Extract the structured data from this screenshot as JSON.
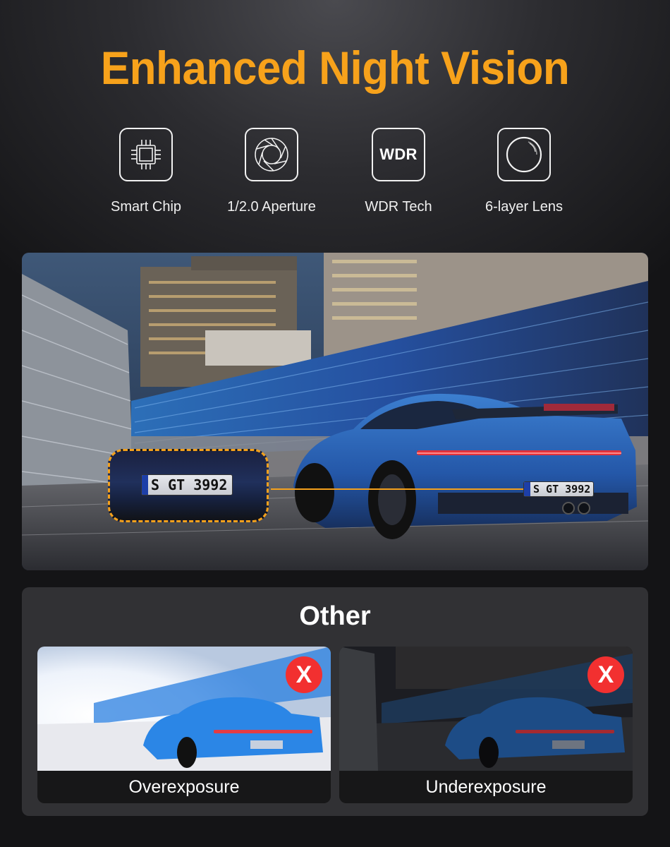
{
  "header": {
    "title": "Enhanced Night Vision",
    "title_color": "#F7A21B"
  },
  "features": [
    {
      "icon": "chip-icon",
      "label": "Smart Chip"
    },
    {
      "icon": "aperture-icon",
      "label": "1/2.0 Aperture"
    },
    {
      "icon": "wdr-icon",
      "icon_text": "WDR",
      "label": "WDR Tech"
    },
    {
      "icon": "lens-icon",
      "label": "6-layer Lens"
    }
  ],
  "hero": {
    "description": "Night-time photo of blue sports car on race track with motion-blurred buildings",
    "license_plate_zoomed": "S GT 3992",
    "license_plate": "S GT 3992",
    "highlight_color": "#F5A11C"
  },
  "other": {
    "title": "Other",
    "cards": [
      {
        "caption": "Overexposure",
        "badge": "X",
        "badge_color": "#F23030"
      },
      {
        "caption": "Underexposure",
        "badge": "X",
        "badge_color": "#F23030"
      }
    ]
  }
}
